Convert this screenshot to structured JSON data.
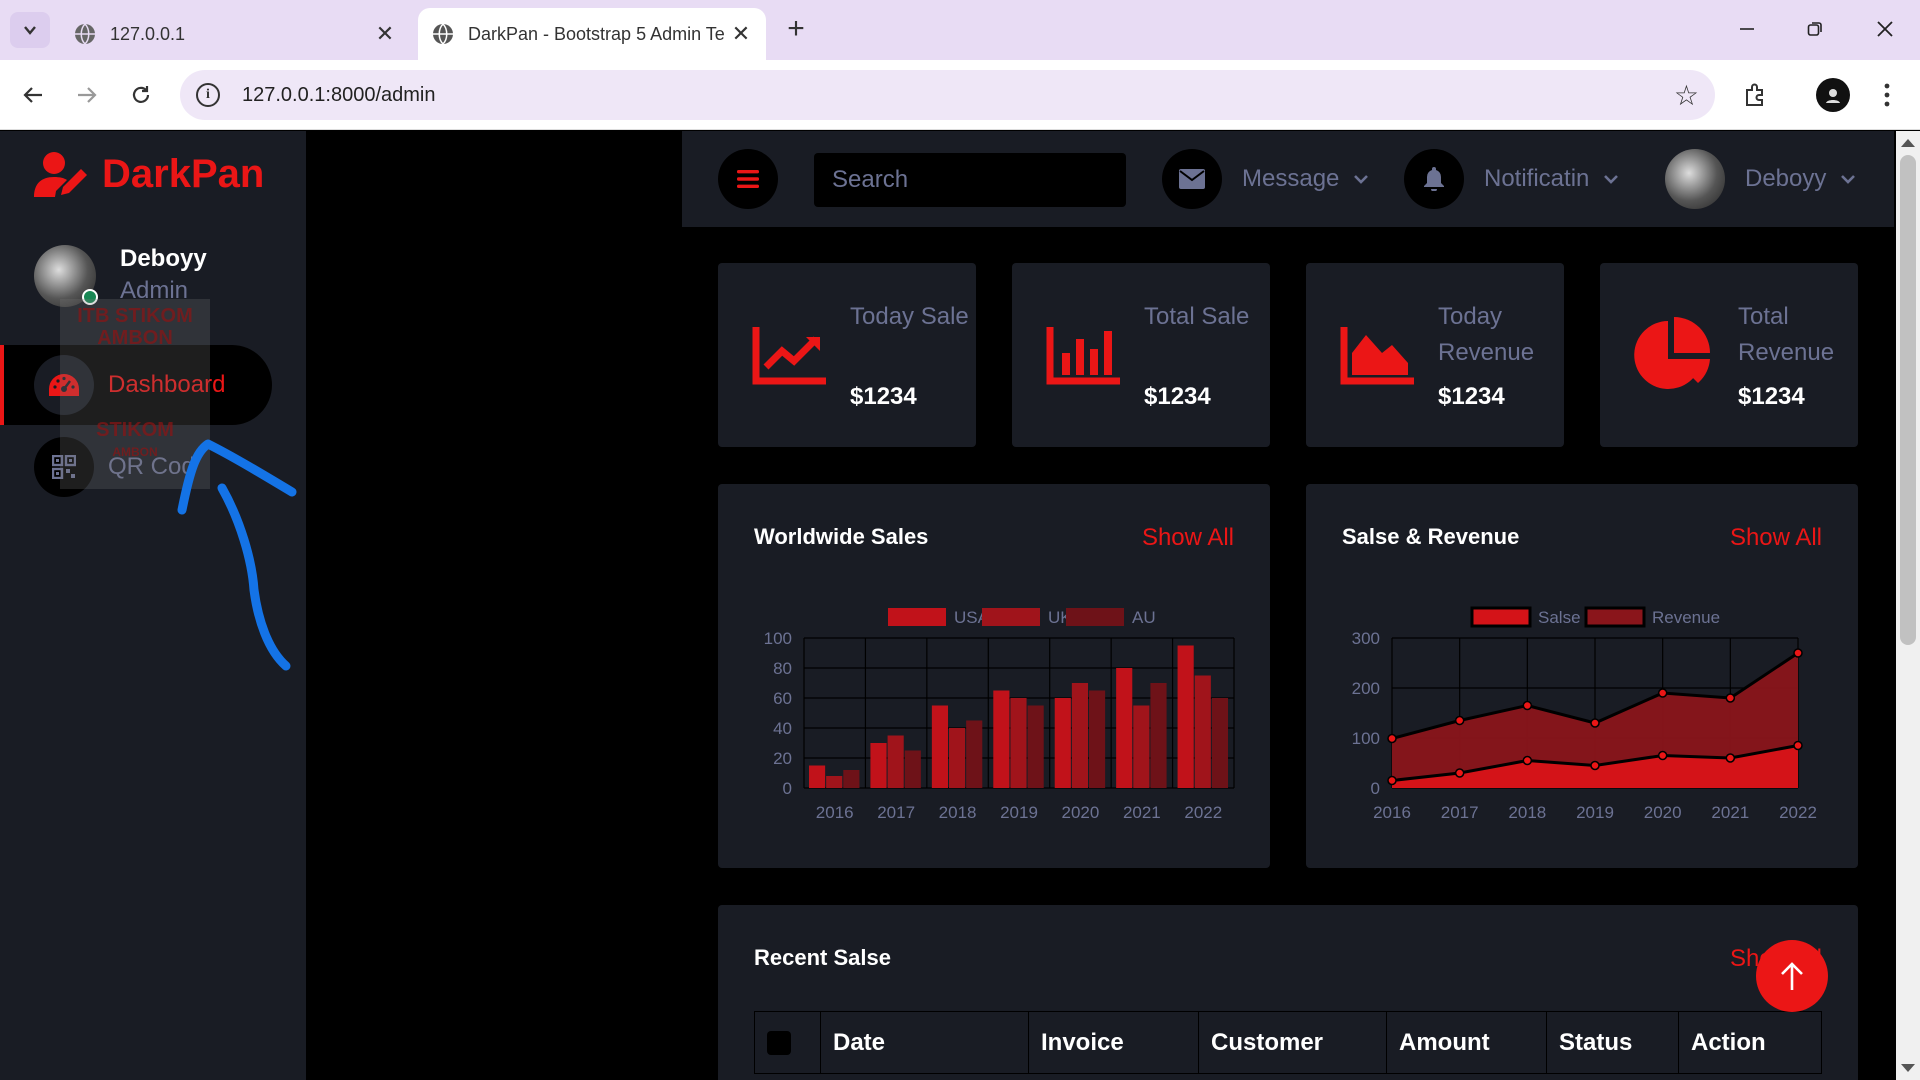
{
  "browser": {
    "tabs": [
      {
        "title": "127.0.0.1",
        "active": false
      },
      {
        "title": "DarkPan - Bootstrap 5 Admin Te",
        "active": true
      }
    ],
    "url": "127.0.0.1:8000/admin"
  },
  "sidebar": {
    "brand": "DarkPan",
    "user": {
      "name": "Deboyy",
      "role": "Admin"
    },
    "items": [
      {
        "label": "Dashboard",
        "icon": "tachometer-icon",
        "active": true
      },
      {
        "label": "QR Cod",
        "icon": "qrcode-icon",
        "active": false
      }
    ],
    "watermark": [
      "ITB STIKOM",
      "AMBON",
      "STIKOM",
      "AMBON"
    ]
  },
  "topbar": {
    "search_placeholder": "Search",
    "message": "Message",
    "notification": "Notificatin",
    "user": "Deboyy"
  },
  "stats": [
    {
      "label": "Today Sale",
      "value": "$1234",
      "icon": "chart-line-icon"
    },
    {
      "label": "Total Sale",
      "value": "$1234",
      "icon": "chart-bar-icon"
    },
    {
      "label": "Today Revenue",
      "value": "$1234",
      "icon": "chart-area-icon"
    },
    {
      "label": "Total Revenue",
      "value": "$1234",
      "icon": "chart-pie-icon"
    }
  ],
  "worldwide": {
    "title": "Worldwide Sales",
    "link": "Show All"
  },
  "salse_revenue": {
    "title": "Salse & Revenue",
    "link": "Show All"
  },
  "recent": {
    "title": "Recent Salse",
    "link": "Show All",
    "columns": [
      "Date",
      "Invoice",
      "Customer",
      "Amount",
      "Status",
      "Action"
    ]
  },
  "colors": {
    "accent": "#EB1616",
    "panel": "#191C24",
    "muted": "#6C7293"
  },
  "chart_data": [
    {
      "type": "bar",
      "categories": [
        "2016",
        "2017",
        "2018",
        "2019",
        "2020",
        "2021",
        "2022"
      ],
      "series": [
        {
          "name": "USA",
          "values": [
            15,
            30,
            55,
            65,
            60,
            80,
            95
          ],
          "color": "#c1121a"
        },
        {
          "name": "UK",
          "values": [
            8,
            35,
            40,
            60,
            70,
            55,
            75
          ],
          "color": "#a0141b"
        },
        {
          "name": "AU",
          "values": [
            12,
            25,
            45,
            55,
            65,
            70,
            60
          ],
          "color": "#6e1218"
        }
      ],
      "ylim": [
        0,
        100
      ],
      "yticks": [
        0,
        20,
        40,
        60,
        80,
        100
      ],
      "grid": true,
      "legend": "top"
    },
    {
      "type": "area",
      "categories": [
        "2016",
        "2017",
        "2018",
        "2019",
        "2020",
        "2021",
        "2022"
      ],
      "series": [
        {
          "name": "Salse",
          "values": [
            15,
            30,
            55,
            45,
            65,
            60,
            85
          ],
          "color": "#d41318"
        },
        {
          "name": "Revenue",
          "values": [
            99,
            135,
            165,
            130,
            190,
            180,
            270
          ],
          "color": "#8a151b"
        }
      ],
      "ylim": [
        0,
        300
      ],
      "yticks": [
        0,
        100,
        200,
        300
      ],
      "grid": true,
      "legend": "top"
    }
  ]
}
